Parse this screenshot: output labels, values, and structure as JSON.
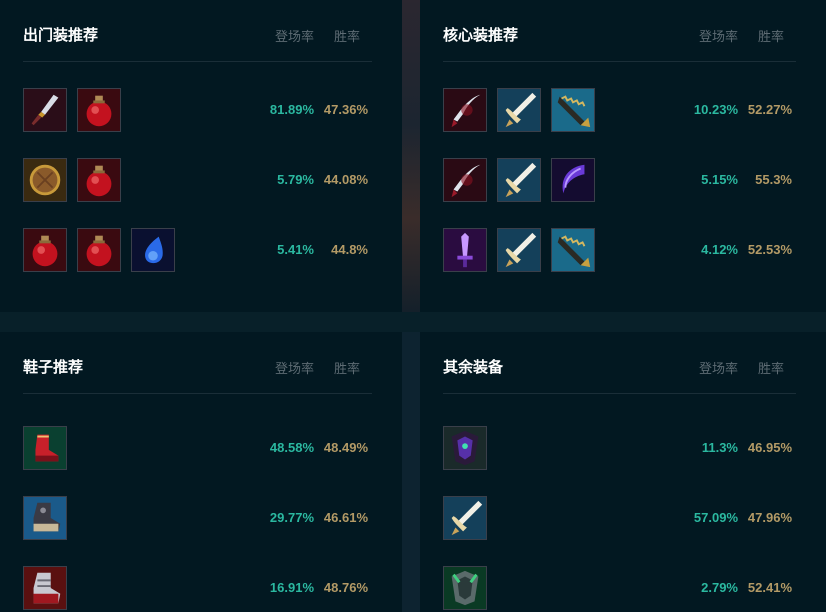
{
  "headers": {
    "pick_rate": "登场率",
    "win_rate": "胜率"
  },
  "starter": {
    "title": "出门装推荐",
    "rows": [
      {
        "icons": [
          "dagger-icon",
          "health-potion-icon"
        ],
        "pick": "81.89%",
        "win": "47.36%"
      },
      {
        "icons": [
          "shield-icon",
          "health-potion-icon"
        ],
        "pick": "5.79%",
        "win": "44.08%"
      },
      {
        "icons": [
          "health-potion-icon",
          "health-potion-icon",
          "blue-orb-icon"
        ],
        "pick": "5.41%",
        "win": "44.8%"
      }
    ]
  },
  "core": {
    "title": "核心装推荐",
    "rows": [
      {
        "icons": [
          "crimson-blade-icon",
          "navori-blade-icon",
          "serrated-saw-icon"
        ],
        "pick": "10.23%",
        "win": "52.27%"
      },
      {
        "icons": [
          "crimson-blade-icon",
          "navori-blade-icon",
          "void-scythe-icon"
        ],
        "pick": "5.15%",
        "win": "55.3%"
      },
      {
        "icons": [
          "violet-sword-icon",
          "navori-blade-icon",
          "serrated-saw-icon"
        ],
        "pick": "4.12%",
        "win": "52.53%"
      }
    ]
  },
  "boots": {
    "title": "鞋子推荐",
    "rows": [
      {
        "icons": [
          "red-boots-icon"
        ],
        "pick": "48.58%",
        "win": "48.49%"
      },
      {
        "icons": [
          "armored-boots-icon"
        ],
        "pick": "29.77%",
        "win": "46.61%"
      },
      {
        "icons": [
          "plated-boots-icon"
        ],
        "pick": "16.91%",
        "win": "48.76%"
      }
    ]
  },
  "other": {
    "title": "其余装备",
    "rows": [
      {
        "icons": [
          "shadow-armor-icon"
        ],
        "pick": "11.3%",
        "win": "46.95%"
      },
      {
        "icons": [
          "navori-blade-icon"
        ],
        "pick": "57.09%",
        "win": "47.96%"
      },
      {
        "icons": [
          "green-armor-icon"
        ],
        "pick": "2.79%",
        "win": "52.41%"
      }
    ]
  },
  "colors": {
    "pick": "#2bb8a0",
    "win": "#b39a66",
    "header": "#5d6b73",
    "panel": "#021821"
  }
}
